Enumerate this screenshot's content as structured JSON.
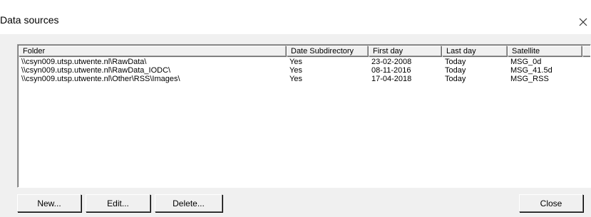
{
  "window": {
    "title": "Data sources",
    "close_icon": "close-icon"
  },
  "sources_list": {
    "columns": [
      {
        "key": "folder",
        "label": "Folder"
      },
      {
        "key": "date_subdirectory",
        "label": "Date Subdirectory"
      },
      {
        "key": "first_day",
        "label": "First day"
      },
      {
        "key": "last_day",
        "label": "Last day"
      },
      {
        "key": "satellite",
        "label": "Satellite"
      }
    ],
    "rows": [
      {
        "folder": "\\\\csyn009.utsp.utwente.nl\\RawData\\",
        "date_subdirectory": "Yes",
        "first_day": "23-02-2008",
        "last_day": "Today",
        "satellite": "MSG_0d"
      },
      {
        "folder": "\\\\csyn009.utsp.utwente.nl\\RawData_IODC\\",
        "date_subdirectory": "Yes",
        "first_day": "08-11-2016",
        "last_day": "Today",
        "satellite": "MSG_41.5d"
      },
      {
        "folder": "\\\\csyn009.utsp.utwente.nl\\Other\\RSS\\Images\\",
        "date_subdirectory": "Yes",
        "first_day": "17-04-2018",
        "last_day": "Today",
        "satellite": "MSG_RSS"
      }
    ]
  },
  "buttons": {
    "new_label": "New...",
    "edit_label": "Edit...",
    "delete_label": "Delete...",
    "close_label": "Close"
  }
}
